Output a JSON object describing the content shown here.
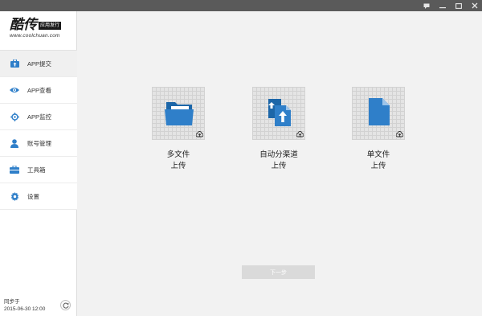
{
  "app": {
    "logo_text": "酷传",
    "logo_badge": "应用发行",
    "logo_url": "www.coolchuan.com"
  },
  "sidebar": {
    "items": [
      {
        "label": "APP提交",
        "icon": "briefcase-upload-icon",
        "active": true
      },
      {
        "label": "APP查看",
        "icon": "eye-icon",
        "active": false
      },
      {
        "label": "APP监控",
        "icon": "target-icon",
        "active": false
      },
      {
        "label": "账号管理",
        "icon": "user-icon",
        "active": false
      },
      {
        "label": "工具箱",
        "icon": "toolbox-icon",
        "active": false
      },
      {
        "label": "设置",
        "icon": "gear-icon",
        "active": false
      }
    ],
    "sync_label": "同步于",
    "sync_time": "2015-06-30 12:00"
  },
  "main": {
    "options": [
      {
        "line1": "多文件",
        "line2": "上传",
        "icon": "folder-icon"
      },
      {
        "line1": "自动分渠道",
        "line2": "上传",
        "icon": "split-files-icon"
      },
      {
        "line1": "单文件",
        "line2": "上传",
        "icon": "file-icon"
      }
    ],
    "next_label": "下一步"
  },
  "colors": {
    "accent": "#2f7fc9",
    "titlebar": "#5a5a5a",
    "icon_dark": "#2a2a2a"
  }
}
